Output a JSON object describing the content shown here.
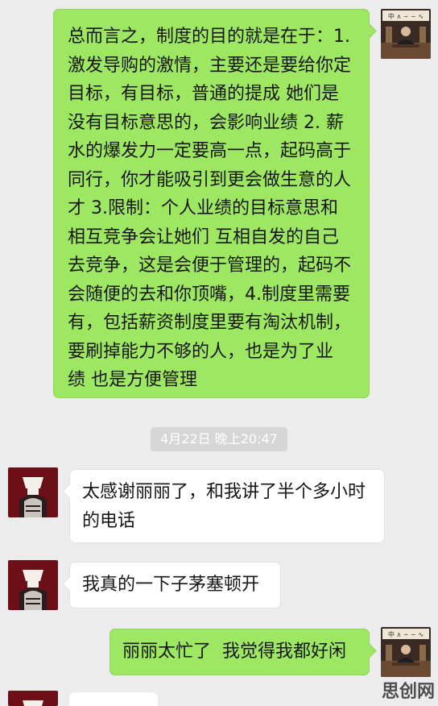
{
  "messages": [
    {
      "side": "right",
      "text": "总而言之，制度的目的就是在于：1.\n激发导购的激情，主要还是要给你定\n目标，有目标，普通的提成 她们是\n没有目标意思的，会影响业绩 2. 薪\n水的爆发力一定要高一点，起码高于\n同行，你才能吸引到更会做生意的人\n才 3.限制：个人业绩的目标意思和\n相互竞争会让她们 互相自发的自己\n去竞争，这是会便于管理的，起码不\n会随便的去和你顶嘴，4.制度里需要\n有，包括薪资制度里要有淘汰机制，\n要刷掉能力不够的人，也是为了业\n绩 也是方便管理"
    },
    {
      "side": "left",
      "text": "太感谢丽丽了，和我讲了半个多小时\n的电话"
    },
    {
      "side": "left",
      "text": "我真的一下子茅塞顿开"
    },
    {
      "side": "right",
      "text": "丽丽太忙了  我觉得我都好闲"
    }
  ],
  "timestamp": "4月22日 晚上20:47",
  "watermark": "思创网",
  "colors": {
    "bubble_self": "#9ee763",
    "bubble_other": "#ffffff",
    "background": "#ececec"
  }
}
